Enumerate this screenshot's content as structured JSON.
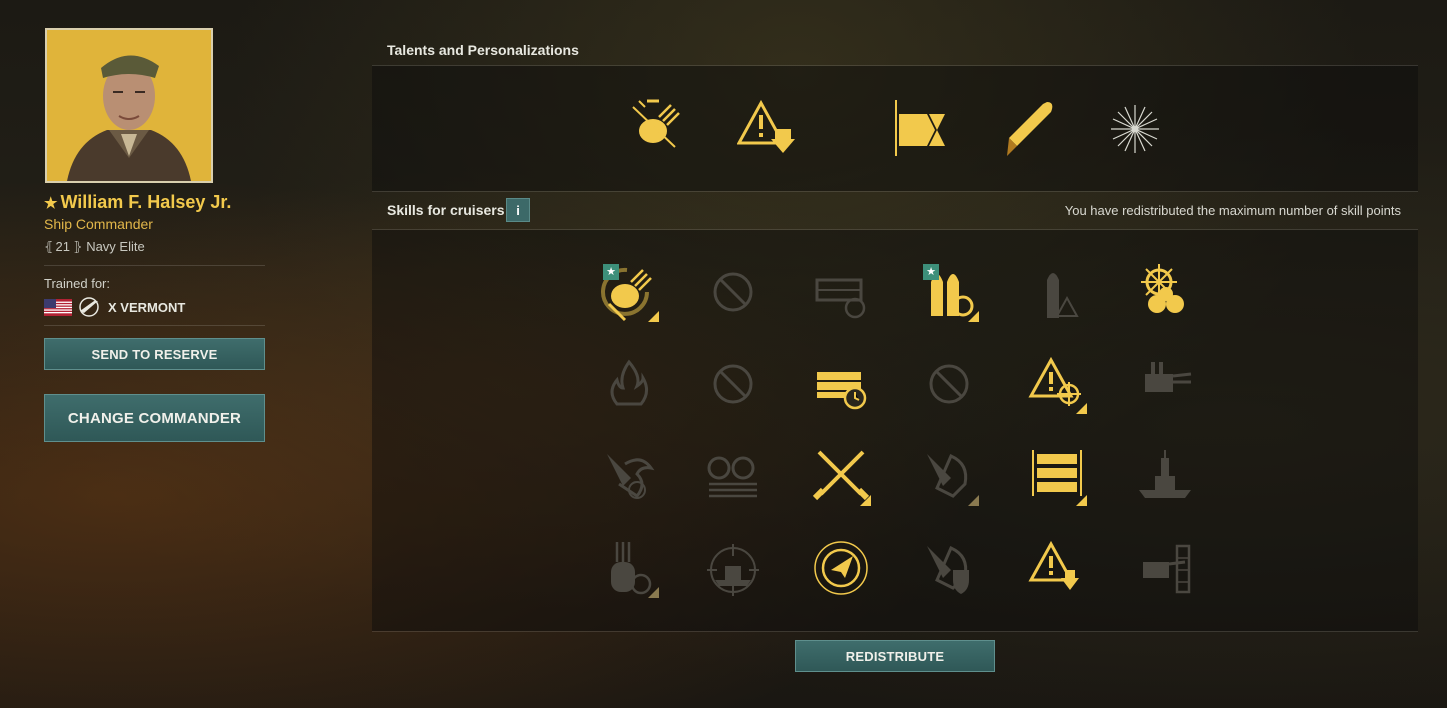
{
  "commander": {
    "name": "William F. Halsey Jr.",
    "star_glyph": "★",
    "role": "Ship Commander",
    "level": "21",
    "rank": "Navy Elite",
    "trained_label": "Trained for:",
    "ship": "X VERMONT",
    "flag_icon": "us-flag-icon",
    "tier_icon": "battleship-class-icon"
  },
  "buttons": {
    "send_to_reserve": "SEND TO RESERVE",
    "change_commander": "CHANGE COMMANDER",
    "redistribute": "REDISTRIBUTE"
  },
  "talents": {
    "title": "Talents and Personalizations",
    "items": [
      {
        "icon": "secondary-battery-talent-icon",
        "active": true
      },
      {
        "icon": "warning-ammo-talent-icon",
        "active": true
      },
      {
        "icon": "flag-talent-icon",
        "active": true
      },
      {
        "icon": "shell-talent-icon",
        "active": true
      },
      {
        "icon": "starburst-talent-icon",
        "active": false
      }
    ]
  },
  "skills": {
    "title": "Skills for cruisers",
    "info_label": "i",
    "note": "You have redistributed the maximum number of skill points",
    "badge_glyph": "★",
    "rows": [
      [
        {
          "icon": "secondary-turret-skill-icon",
          "learned": true,
          "badge": true,
          "corner": true
        },
        {
          "icon": "unavailable-icon",
          "learned": false,
          "badge": false,
          "corner": false
        },
        {
          "icon": "consumable-reload-icon",
          "learned": false,
          "badge": false,
          "corner": false
        },
        {
          "icon": "shells-reload-skill-icon",
          "learned": true,
          "badge": true,
          "corner": true
        },
        {
          "icon": "shell-warning-icon",
          "learned": false,
          "badge": false,
          "corner": false
        },
        {
          "icon": "helm-engine-skill-icon",
          "learned": true,
          "badge": false,
          "corner": false
        }
      ],
      [
        {
          "icon": "fire-icon",
          "learned": false,
          "badge": false,
          "corner": false
        },
        {
          "icon": "unavailable-icon",
          "learned": false,
          "badge": false,
          "corner": false
        },
        {
          "icon": "consumable-timer-skill-icon",
          "learned": true,
          "badge": false,
          "corner": false
        },
        {
          "icon": "unavailable-icon",
          "learned": false,
          "badge": false,
          "corner": false
        },
        {
          "icon": "warning-target-skill-icon",
          "learned": true,
          "badge": false,
          "corner": true
        },
        {
          "icon": "main-battery-icon",
          "learned": false,
          "badge": false,
          "corner": false
        }
      ],
      [
        {
          "icon": "demolition-expert-icon",
          "learned": false,
          "badge": false,
          "corner": false
        },
        {
          "icon": "turret-ammo-icon",
          "learned": false,
          "badge": false,
          "corner": false
        },
        {
          "icon": "crossed-shells-skill-icon",
          "learned": true,
          "badge": false,
          "corner": true
        },
        {
          "icon": "fire-damage-icon",
          "learned": false,
          "badge": false,
          "corner": true
        },
        {
          "icon": "extra-consumables-skill-icon",
          "learned": true,
          "badge": false,
          "corner": true
        },
        {
          "icon": "battleship-icon",
          "learned": false,
          "badge": false,
          "corner": false
        }
      ],
      [
        {
          "icon": "turret-reload-icon",
          "learned": false,
          "badge": false,
          "corner": true
        },
        {
          "icon": "ship-target-icon",
          "learned": false,
          "badge": false,
          "corner": false
        },
        {
          "icon": "radar-skill-icon",
          "learned": true,
          "badge": false,
          "corner": false
        },
        {
          "icon": "fire-shield-icon",
          "learned": false,
          "badge": false,
          "corner": false
        },
        {
          "icon": "warning-down-skill-icon",
          "learned": true,
          "badge": false,
          "corner": false
        },
        {
          "icon": "armor-turret-icon",
          "learned": false,
          "badge": false,
          "corner": false
        }
      ]
    ]
  },
  "colors": {
    "accent_gold": "#f2c94c",
    "inactive_gray": "#4a4740",
    "button_teal": "#3a6867",
    "badge_green": "#3d8f7a"
  }
}
